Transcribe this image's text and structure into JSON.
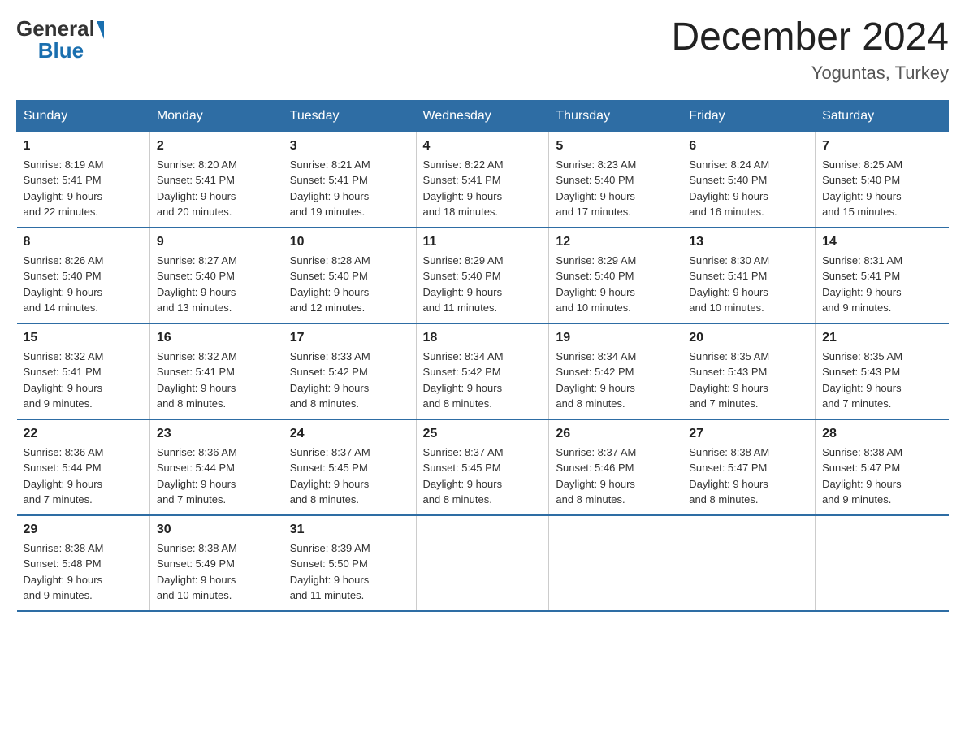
{
  "header": {
    "logo_general": "General",
    "logo_blue": "Blue",
    "title": "December 2024",
    "subtitle": "Yoguntas, Turkey"
  },
  "weekdays": [
    "Sunday",
    "Monday",
    "Tuesday",
    "Wednesday",
    "Thursday",
    "Friday",
    "Saturday"
  ],
  "weeks": [
    [
      {
        "day": "1",
        "sunrise": "8:19 AM",
        "sunset": "5:41 PM",
        "daylight": "9 hours and 22 minutes."
      },
      {
        "day": "2",
        "sunrise": "8:20 AM",
        "sunset": "5:41 PM",
        "daylight": "9 hours and 20 minutes."
      },
      {
        "day": "3",
        "sunrise": "8:21 AM",
        "sunset": "5:41 PM",
        "daylight": "9 hours and 19 minutes."
      },
      {
        "day": "4",
        "sunrise": "8:22 AM",
        "sunset": "5:41 PM",
        "daylight": "9 hours and 18 minutes."
      },
      {
        "day": "5",
        "sunrise": "8:23 AM",
        "sunset": "5:40 PM",
        "daylight": "9 hours and 17 minutes."
      },
      {
        "day": "6",
        "sunrise": "8:24 AM",
        "sunset": "5:40 PM",
        "daylight": "9 hours and 16 minutes."
      },
      {
        "day": "7",
        "sunrise": "8:25 AM",
        "sunset": "5:40 PM",
        "daylight": "9 hours and 15 minutes."
      }
    ],
    [
      {
        "day": "8",
        "sunrise": "8:26 AM",
        "sunset": "5:40 PM",
        "daylight": "9 hours and 14 minutes."
      },
      {
        "day": "9",
        "sunrise": "8:27 AM",
        "sunset": "5:40 PM",
        "daylight": "9 hours and 13 minutes."
      },
      {
        "day": "10",
        "sunrise": "8:28 AM",
        "sunset": "5:40 PM",
        "daylight": "9 hours and 12 minutes."
      },
      {
        "day": "11",
        "sunrise": "8:29 AM",
        "sunset": "5:40 PM",
        "daylight": "9 hours and 11 minutes."
      },
      {
        "day": "12",
        "sunrise": "8:29 AM",
        "sunset": "5:40 PM",
        "daylight": "9 hours and 10 minutes."
      },
      {
        "day": "13",
        "sunrise": "8:30 AM",
        "sunset": "5:41 PM",
        "daylight": "9 hours and 10 minutes."
      },
      {
        "day": "14",
        "sunrise": "8:31 AM",
        "sunset": "5:41 PM",
        "daylight": "9 hours and 9 minutes."
      }
    ],
    [
      {
        "day": "15",
        "sunrise": "8:32 AM",
        "sunset": "5:41 PM",
        "daylight": "9 hours and 9 minutes."
      },
      {
        "day": "16",
        "sunrise": "8:32 AM",
        "sunset": "5:41 PM",
        "daylight": "9 hours and 8 minutes."
      },
      {
        "day": "17",
        "sunrise": "8:33 AM",
        "sunset": "5:42 PM",
        "daylight": "9 hours and 8 minutes."
      },
      {
        "day": "18",
        "sunrise": "8:34 AM",
        "sunset": "5:42 PM",
        "daylight": "9 hours and 8 minutes."
      },
      {
        "day": "19",
        "sunrise": "8:34 AM",
        "sunset": "5:42 PM",
        "daylight": "9 hours and 8 minutes."
      },
      {
        "day": "20",
        "sunrise": "8:35 AM",
        "sunset": "5:43 PM",
        "daylight": "9 hours and 7 minutes."
      },
      {
        "day": "21",
        "sunrise": "8:35 AM",
        "sunset": "5:43 PM",
        "daylight": "9 hours and 7 minutes."
      }
    ],
    [
      {
        "day": "22",
        "sunrise": "8:36 AM",
        "sunset": "5:44 PM",
        "daylight": "9 hours and 7 minutes."
      },
      {
        "day": "23",
        "sunrise": "8:36 AM",
        "sunset": "5:44 PM",
        "daylight": "9 hours and 7 minutes."
      },
      {
        "day": "24",
        "sunrise": "8:37 AM",
        "sunset": "5:45 PM",
        "daylight": "9 hours and 8 minutes."
      },
      {
        "day": "25",
        "sunrise": "8:37 AM",
        "sunset": "5:45 PM",
        "daylight": "9 hours and 8 minutes."
      },
      {
        "day": "26",
        "sunrise": "8:37 AM",
        "sunset": "5:46 PM",
        "daylight": "9 hours and 8 minutes."
      },
      {
        "day": "27",
        "sunrise": "8:38 AM",
        "sunset": "5:47 PM",
        "daylight": "9 hours and 8 minutes."
      },
      {
        "day": "28",
        "sunrise": "8:38 AM",
        "sunset": "5:47 PM",
        "daylight": "9 hours and 9 minutes."
      }
    ],
    [
      {
        "day": "29",
        "sunrise": "8:38 AM",
        "sunset": "5:48 PM",
        "daylight": "9 hours and 9 minutes."
      },
      {
        "day": "30",
        "sunrise": "8:38 AM",
        "sunset": "5:49 PM",
        "daylight": "9 hours and 10 minutes."
      },
      {
        "day": "31",
        "sunrise": "8:39 AM",
        "sunset": "5:50 PM",
        "daylight": "9 hours and 11 minutes."
      },
      null,
      null,
      null,
      null
    ]
  ],
  "labels": {
    "sunrise": "Sunrise:",
    "sunset": "Sunset:",
    "daylight": "Daylight:"
  }
}
